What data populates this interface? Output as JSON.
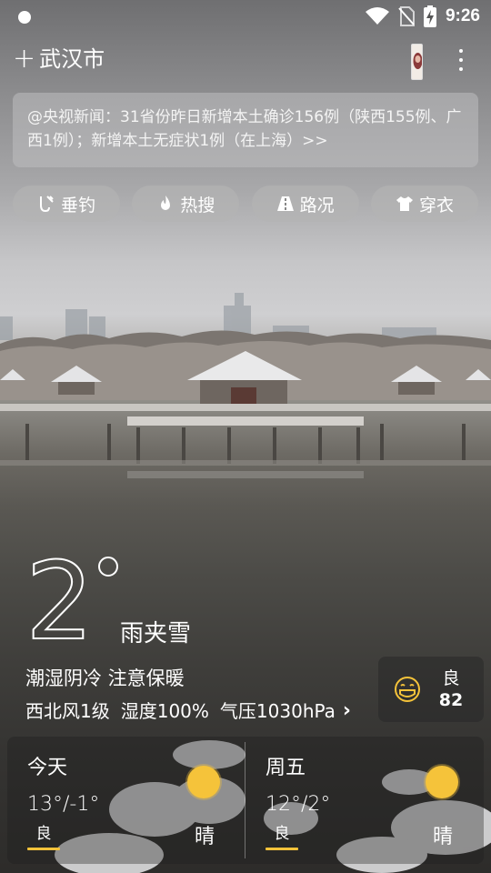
{
  "status_bar": {
    "time": "9:26",
    "icons": [
      "notification-dot-icon",
      "wifi-icon",
      "no-sim-icon",
      "battery-charging-icon"
    ]
  },
  "header": {
    "add_icon": "+",
    "city": "武汉市",
    "more_icon": "more-vert-icon"
  },
  "news": {
    "text": "@央视新闻：31省份昨日新增本土确诊156例（陕西155例、广西1例）；新增本土无症状1例（在上海）>>"
  },
  "chips": [
    {
      "label": "垂钓",
      "icon": "fishing-icon"
    },
    {
      "label": "热搜",
      "icon": "flame-icon"
    },
    {
      "label": "路况",
      "icon": "road-icon"
    },
    {
      "label": "穿衣",
      "icon": "shirt-icon"
    }
  ],
  "current": {
    "temperature": "2",
    "condition": "雨夹雪",
    "advice": "潮湿阴冷 注意保暖",
    "wind": "西北风1级",
    "humidity": "湿度100%",
    "pressure": "气压1030hPa",
    "chevron": "›"
  },
  "aqi": {
    "level": "良",
    "value": "82",
    "icon": "face-mask-icon"
  },
  "forecast": [
    {
      "day": "今天",
      "temp": "13°/-1°",
      "air_quality": "良",
      "condition": "晴",
      "icon": "sun-icon"
    },
    {
      "day": "周五",
      "temp": "12°/2°",
      "air_quality": "良",
      "condition": "晴",
      "icon": "sun-icon"
    }
  ],
  "colors": {
    "aqi_accent": "#f5c33a",
    "sun": "#f5c33a"
  }
}
